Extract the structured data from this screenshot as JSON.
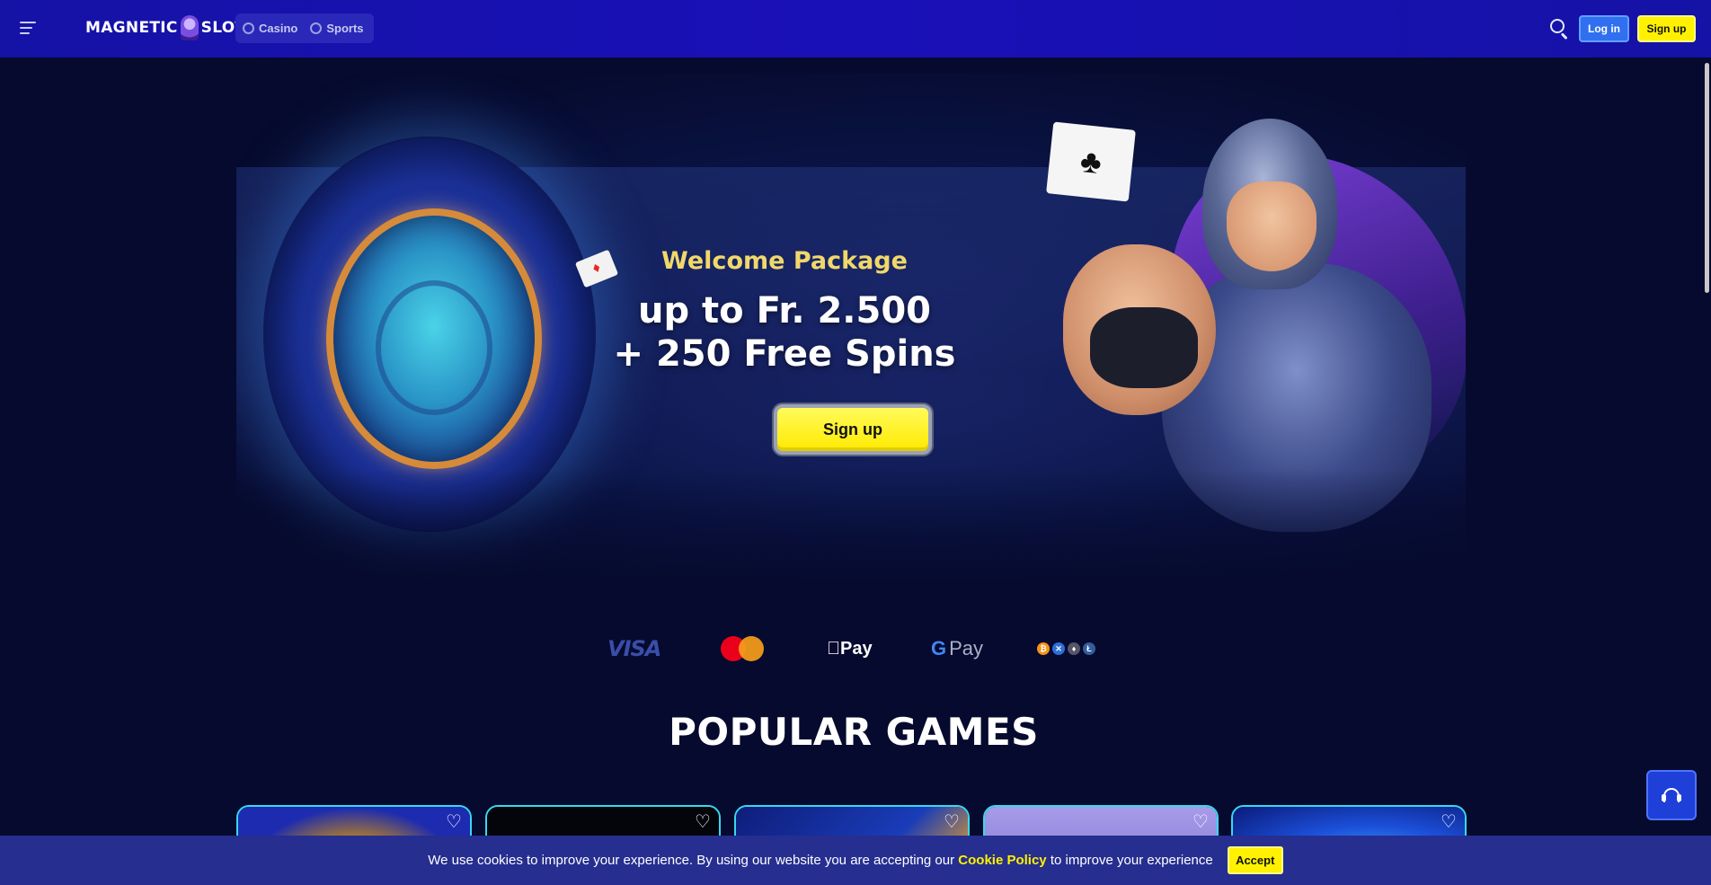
{
  "header": {
    "logo_text_left": "MAGNETIC",
    "logo_text_right": "SLOTS",
    "nav": [
      {
        "label": "Casino",
        "icon": "casino-chip-icon"
      },
      {
        "label": "Sports",
        "icon": "sports-ball-icon"
      }
    ],
    "login_label": "Log in",
    "signup_label": "Sign up"
  },
  "hero": {
    "welcome": "Welcome Package",
    "headline_line1": "up to Fr. 2.500",
    "headline_line2": "+ 250 Free Spins",
    "cta_label": "Sign up"
  },
  "payments": {
    "visa": "VISA",
    "apple_pay": "Pay",
    "google_pay": "Pay",
    "crypto": [
      "₿",
      "✕",
      "♦",
      "Ł"
    ]
  },
  "popular": {
    "title": "POPULAR GAMES"
  },
  "cookie": {
    "text_before": "We use cookies to improve your experience. By using our website you are accepting our ",
    "link": "Cookie Policy",
    "text_after": " to improve your experience",
    "accept_label": "Accept"
  },
  "colors": {
    "accent_yellow": "#fff100",
    "header_blue": "#1512a6",
    "card_border": "#36d9f0",
    "page_bg": "#060a2e"
  }
}
